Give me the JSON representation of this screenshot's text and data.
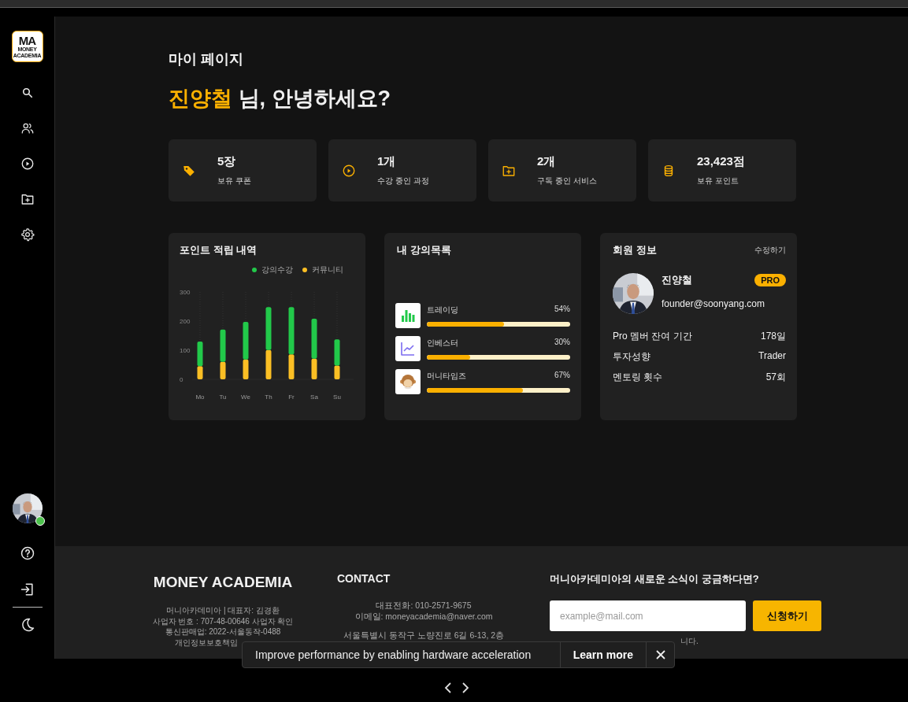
{
  "sidebar": {
    "logo": {
      "mark": "MA",
      "caption": "MONEY ACADEMIA"
    },
    "nav": [
      {
        "kind": "search"
      },
      {
        "kind": "users"
      },
      {
        "kind": "play"
      },
      {
        "kind": "folder"
      },
      {
        "kind": "settings"
      }
    ],
    "user": {
      "online": true
    },
    "bottom": [
      {
        "kind": "help"
      },
      {
        "kind": "logout"
      },
      {
        "kind": "theme"
      }
    ]
  },
  "header": {
    "title": "마이 페이지",
    "name": "진양철",
    "greeting": "님, 안녕하세요?"
  },
  "stats": [
    {
      "kind": "coupon",
      "value": "5장",
      "label": "보유 쿠폰"
    },
    {
      "kind": "play",
      "value": "1개",
      "label": "수강 중인 과정"
    },
    {
      "kind": "folder",
      "value": "2개",
      "label": "구독 중인 서비스"
    },
    {
      "kind": "coins",
      "value": "23,423점",
      "label": "보유 포인트"
    }
  ],
  "points_panel": {
    "title": "포인트 적립 내역",
    "chart_data": {
      "type": "bar",
      "stacked": true,
      "grid": true,
      "categories": [
        "Mo",
        "Tu",
        "We",
        "Th",
        "Fr",
        "Sa",
        "Su"
      ],
      "ylim": [
        0,
        300
      ],
      "yticks": [
        0,
        100,
        200,
        300
      ],
      "series": [
        {
          "name": "강의수강",
          "color": "#22c94a",
          "values": [
            85,
            111,
            129,
            147,
            162,
            137,
            90
          ]
        },
        {
          "name": "커뮤니티",
          "color": "#fbbf24",
          "values": [
            45,
            60,
            68,
            101,
            86,
            71,
            47
          ]
        }
      ]
    }
  },
  "courses_panel": {
    "title": "내 강의목록",
    "courses": [
      {
        "kind": "bars",
        "name": "트레이딩",
        "percent": "54%",
        "level": 0.54
      },
      {
        "kind": "line",
        "name": "인베스터",
        "percent": "30%",
        "level": 0.3
      },
      {
        "kind": "monkey",
        "name": "머니타임즈",
        "percent": "67%",
        "level": 0.67
      }
    ]
  },
  "member_panel": {
    "title": "회원 정보",
    "edit": "수정하기",
    "name": "진양철",
    "badge": "PRO",
    "email": "founder@soonyang.com",
    "rows": [
      {
        "label": "Pro 멤버 잔여 기간",
        "value": "178일"
      },
      {
        "label": "투자성향",
        "value": "Trader"
      },
      {
        "label": "멘토링 횟수",
        "value": "57회"
      }
    ]
  },
  "footer": {
    "brand": "MONEY ACADEMIA",
    "company_lines": [
      "머니아카데미아 | 대표자: 김경환",
      "사업자 번호 : 707-48-00646 사업자 확인",
      "통신판매업: 2022-서울동작-0488",
      "개인정보보호책임"
    ],
    "contact_title": "CONTACT",
    "contact_lines": [
      "대표전화: 010-2571-9675",
      "이메일: moneyacademia@naver.com"
    ],
    "address": "서울특별시 동작구 노량진로 6길 6-13, 2층",
    "newsletter_title": "머니아카데미아의 새로운 소식이 궁금하다면?",
    "email_placeholder": "example@mail.com",
    "subscribe": "신청하기",
    "note": "니다."
  },
  "toast": {
    "message": "Improve performance by enabling hardware acceleration",
    "action": "Learn more"
  }
}
